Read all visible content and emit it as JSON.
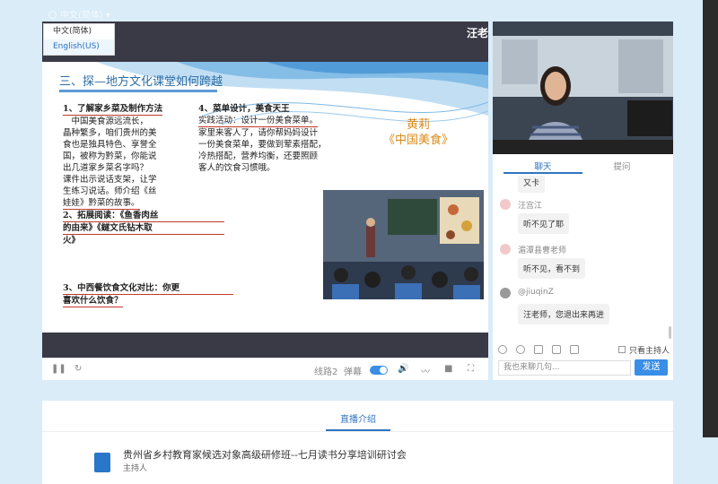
{
  "top": {
    "lang_link": "中文(简体)"
  },
  "lang_menu": {
    "options": [
      "中文(简体)",
      "English(US)"
    ]
  },
  "player": {
    "teacher_tag": "汪老",
    "slide": {
      "title": "三、探—地方文化课堂如何跨越",
      "teacher_name": "黄莉",
      "lesson": "《中国美食》",
      "left_lines": [
        "1、了解家乡菜及制作方法",
        "　中国美食源远流长，",
        "晶种繁多，咱们贵州的美",
        "食也是独具特色、享誉全",
        "国，被称为黔菜，你能说",
        "出几道家乡菜名字吗？",
        "课件出示说话支架，让学",
        "生练习说话。师介绍《丝",
        "娃娃》黔菜的故事。",
        "2、拓展阅读：《鱼香肉丝",
        "的由来》《鐩文氏钻木取",
        "火》"
      ],
      "point3": [
        "3、中西餐饮食文化对比：你更",
        "喜欢什么饮食？"
      ],
      "right_lines": [
        "4、菜单设计，美食天王",
        "实践活动：设计一份美食菜单。",
        "家里来客人了，请你帮妈妈设计",
        "一份美食菜单，要做到荤素搭配，",
        "冷热搭配，营养均衡，还要照顾",
        "客人的饮食习惯哦。"
      ]
    },
    "controls": {
      "route": "线路2",
      "danmu": "弹幕"
    }
  },
  "chat_panel": {
    "tabs": {
      "chat": "聊天",
      "ask": "提问"
    },
    "messages": [
      {
        "name": "",
        "text": "又卡"
      },
      {
        "name": "汪宫江",
        "text": "听不见了耶"
      },
      {
        "name": "湄潭县曹老师",
        "text": "听不见，看不到"
      },
      {
        "name": "@jiuqinZ",
        "text": "汪老师，您退出来再进"
      }
    ],
    "host_only": "只看主持人",
    "input_placeholder": "我也来聊几句...",
    "send": "发送"
  },
  "info": {
    "tab": "直播介绍",
    "course_title": "贵州省乡村教育家候选对象高级研修班--七月读书分享培训研讨会",
    "role": "主持人"
  }
}
